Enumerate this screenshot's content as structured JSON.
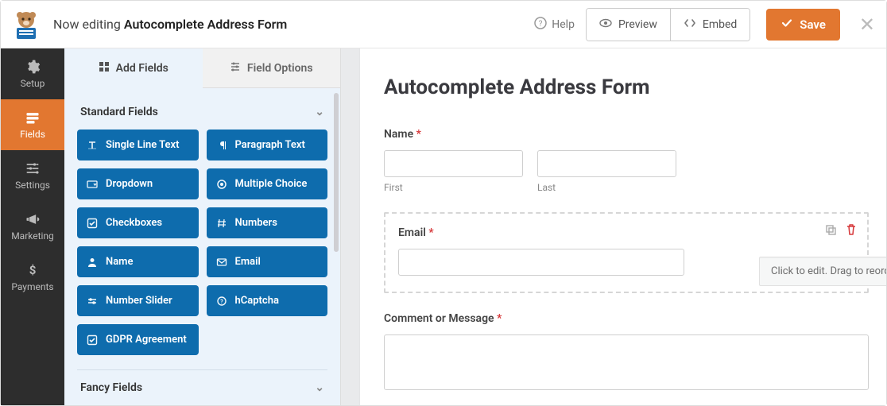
{
  "topbar": {
    "editing_prefix": "Now editing ",
    "form_name": "Autocomplete Address Form",
    "help": "Help",
    "preview": "Preview",
    "embed": "Embed",
    "save": "Save"
  },
  "rail": {
    "items": [
      {
        "key": "setup",
        "label": "Setup"
      },
      {
        "key": "fields",
        "label": "Fields"
      },
      {
        "key": "settings",
        "label": "Settings"
      },
      {
        "key": "marketing",
        "label": "Marketing"
      },
      {
        "key": "payments",
        "label": "Payments"
      }
    ],
    "active": "fields"
  },
  "panel": {
    "tabs": {
      "add": "Add Fields",
      "options": "Field Options"
    },
    "sections": {
      "standard": {
        "title": "Standard Fields",
        "fields": [
          {
            "label": "Single Line Text",
            "icon": "text"
          },
          {
            "label": "Paragraph Text",
            "icon": "paragraph"
          },
          {
            "label": "Dropdown",
            "icon": "dropdown"
          },
          {
            "label": "Multiple Choice",
            "icon": "radio"
          },
          {
            "label": "Checkboxes",
            "icon": "check"
          },
          {
            "label": "Numbers",
            "icon": "hash"
          },
          {
            "label": "Name",
            "icon": "person"
          },
          {
            "label": "Email",
            "icon": "mail"
          },
          {
            "label": "Number Slider",
            "icon": "slider"
          },
          {
            "label": "hCaptcha",
            "icon": "shield"
          },
          {
            "label": "GDPR Agreement",
            "icon": "check"
          }
        ]
      },
      "fancy": {
        "title": "Fancy Fields"
      }
    }
  },
  "form": {
    "title": "Autocomplete Address Form",
    "name_label": "Name",
    "first_sub": "First",
    "last_sub": "Last",
    "email_label": "Email",
    "comment_label": "Comment or Message",
    "tooltip": "Click to edit. Drag to reorder."
  }
}
